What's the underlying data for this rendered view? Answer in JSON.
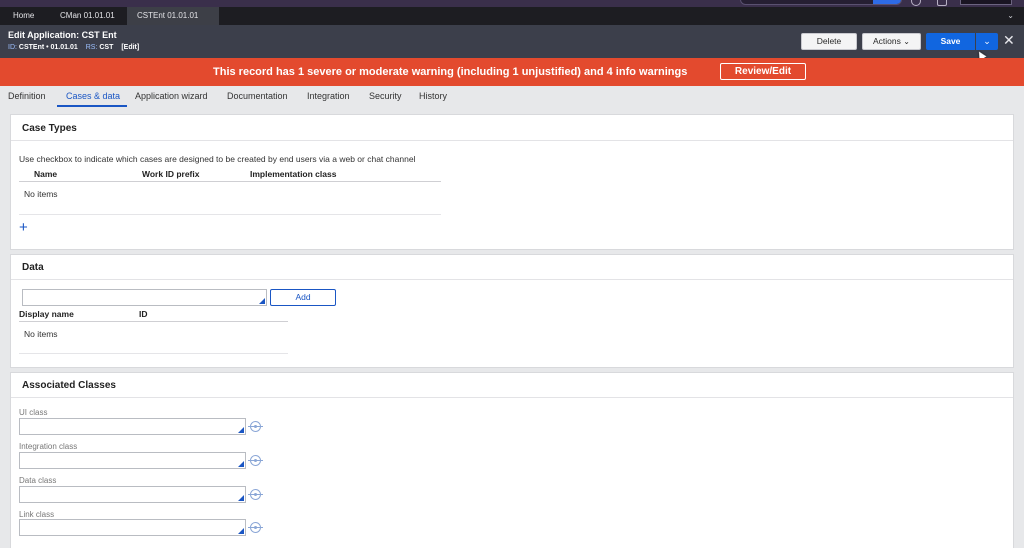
{
  "doc_tabs": [
    {
      "label": "Home"
    },
    {
      "label": "CMan 01.01.01"
    },
    {
      "label": "CSTEnt 01.01.01"
    }
  ],
  "header": {
    "title": "Edit Application: CST Ent",
    "id_key": "ID:",
    "id_value": "CSTEnt • 01.01.01",
    "rs_key": "RS:",
    "rs_value": "CST",
    "edit_link": "[Edit]"
  },
  "toolbar": {
    "delete_label": "Delete",
    "actions_label": "Actions",
    "save_label": "Save"
  },
  "colors": {
    "warning_banner": "#e34a2e",
    "primary": "#1166e0",
    "header_bg": "#3c3f4b"
  },
  "warning": {
    "message": "This record has 1 severe or moderate warning (including 1 unjustified) and 4 info warnings",
    "review_label": "Review/Edit"
  },
  "tabs": [
    {
      "label": "Definition"
    },
    {
      "label": "Cases & data",
      "active": true
    },
    {
      "label": "Application wizard"
    },
    {
      "label": "Documentation"
    },
    {
      "label": "Integration"
    },
    {
      "label": "Security"
    },
    {
      "label": "History"
    }
  ],
  "case_types": {
    "title": "Case Types",
    "instruction": "Use checkbox to indicate which cases are designed to be created by end users via a web or chat channel",
    "columns": [
      "Name",
      "Work ID prefix",
      "Implementation class"
    ],
    "empty_text": "No items",
    "add_icon": "plus-icon"
  },
  "data_section": {
    "title": "Data",
    "add_label": "Add",
    "columns": [
      "Display name",
      "ID"
    ],
    "empty_text": "No items"
  },
  "associated_classes": {
    "title": "Associated Classes",
    "fields": [
      {
        "label": "UI class",
        "value": ""
      },
      {
        "label": "Integration class",
        "value": ""
      },
      {
        "label": "Data class",
        "value": ""
      },
      {
        "label": "Link class",
        "value": ""
      }
    ],
    "field_icon": "target-icon"
  }
}
